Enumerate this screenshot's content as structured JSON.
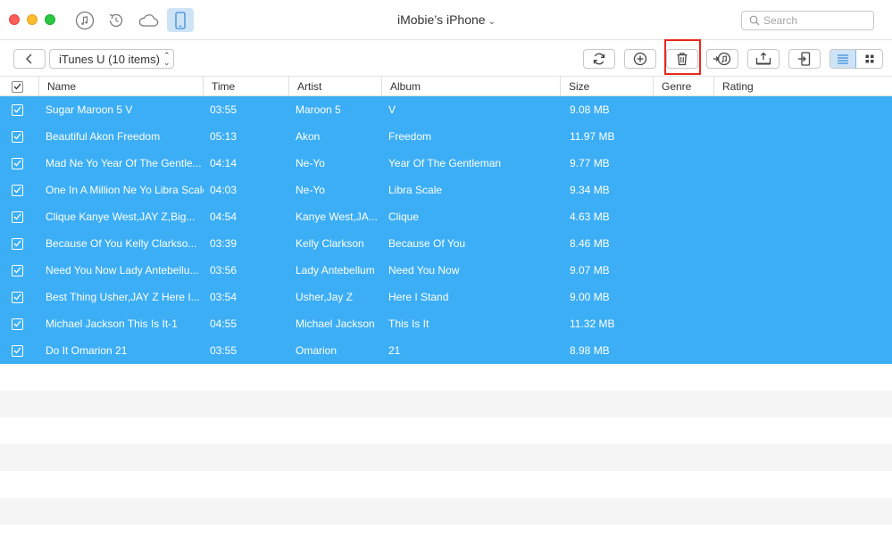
{
  "window": {
    "device_title": "iMobie’s iPhone"
  },
  "search": {
    "placeholder": "Search"
  },
  "toolbar": {
    "category_label": "iTunes U (10 items)"
  },
  "columns": {
    "name": "Name",
    "time": "Time",
    "artist": "Artist",
    "album": "Album",
    "size": "Size",
    "genre": "Genre",
    "rating": "Rating"
  },
  "rows": [
    {
      "name": "Sugar Maroon 5 V",
      "time": "03:55",
      "artist": "Maroon 5",
      "album": "V",
      "size": "9.08 MB"
    },
    {
      "name": "Beautiful Akon Freedom",
      "time": "05:13",
      "artist": "Akon",
      "album": "Freedom",
      "size": "11.97 MB"
    },
    {
      "name": "Mad Ne Yo Year Of The Gentle...",
      "time": "04:14",
      "artist": "Ne-Yo",
      "album": "Year Of The Gentleman",
      "size": "9.77 MB"
    },
    {
      "name": "One In A Million Ne Yo Libra Scale",
      "time": "04:03",
      "artist": "Ne-Yo",
      "album": "Libra Scale",
      "size": "9.34 MB"
    },
    {
      "name": "Clique Kanye West,JAY Z,Big...",
      "time": "04:54",
      "artist": "Kanye West,JA...",
      "album": "Clique",
      "size": "4.63 MB"
    },
    {
      "name": "Because Of You Kelly Clarkso...",
      "time": "03:39",
      "artist": "Kelly Clarkson",
      "album": "Because Of You",
      "size": "8.46 MB"
    },
    {
      "name": "Need You Now Lady Antebellu...",
      "time": "03:56",
      "artist": "Lady Antebellum",
      "album": "Need You Now",
      "size": "9.07 MB"
    },
    {
      "name": "Best Thing Usher,JAY Z Here I...",
      "time": "03:54",
      "artist": "Usher,Jay Z",
      "album": "Here I Stand",
      "size": "9.00 MB"
    },
    {
      "name": " Michael Jackson This Is It-1",
      "time": "04:55",
      "artist": "Michael Jackson",
      "album": "This Is It",
      "size": "11.32 MB"
    },
    {
      "name": "Do It Omarion 21",
      "time": "03:55",
      "artist": "Omarion",
      "album": "21",
      "size": "8.98 MB"
    }
  ],
  "colors": {
    "selection": "#3caef5",
    "highlight": "#e8291c",
    "active_tab": "#cfe3f6"
  },
  "icons": [
    "music-icon",
    "restore-icon",
    "cloud-icon",
    "phone-icon",
    "search-icon",
    "back-arrow-icon",
    "refresh-icon",
    "add-icon",
    "trash-icon",
    "to-itunes-icon",
    "export-to-computer-icon",
    "send-to-device-icon",
    "list-view-icon",
    "grid-view-icon"
  ]
}
